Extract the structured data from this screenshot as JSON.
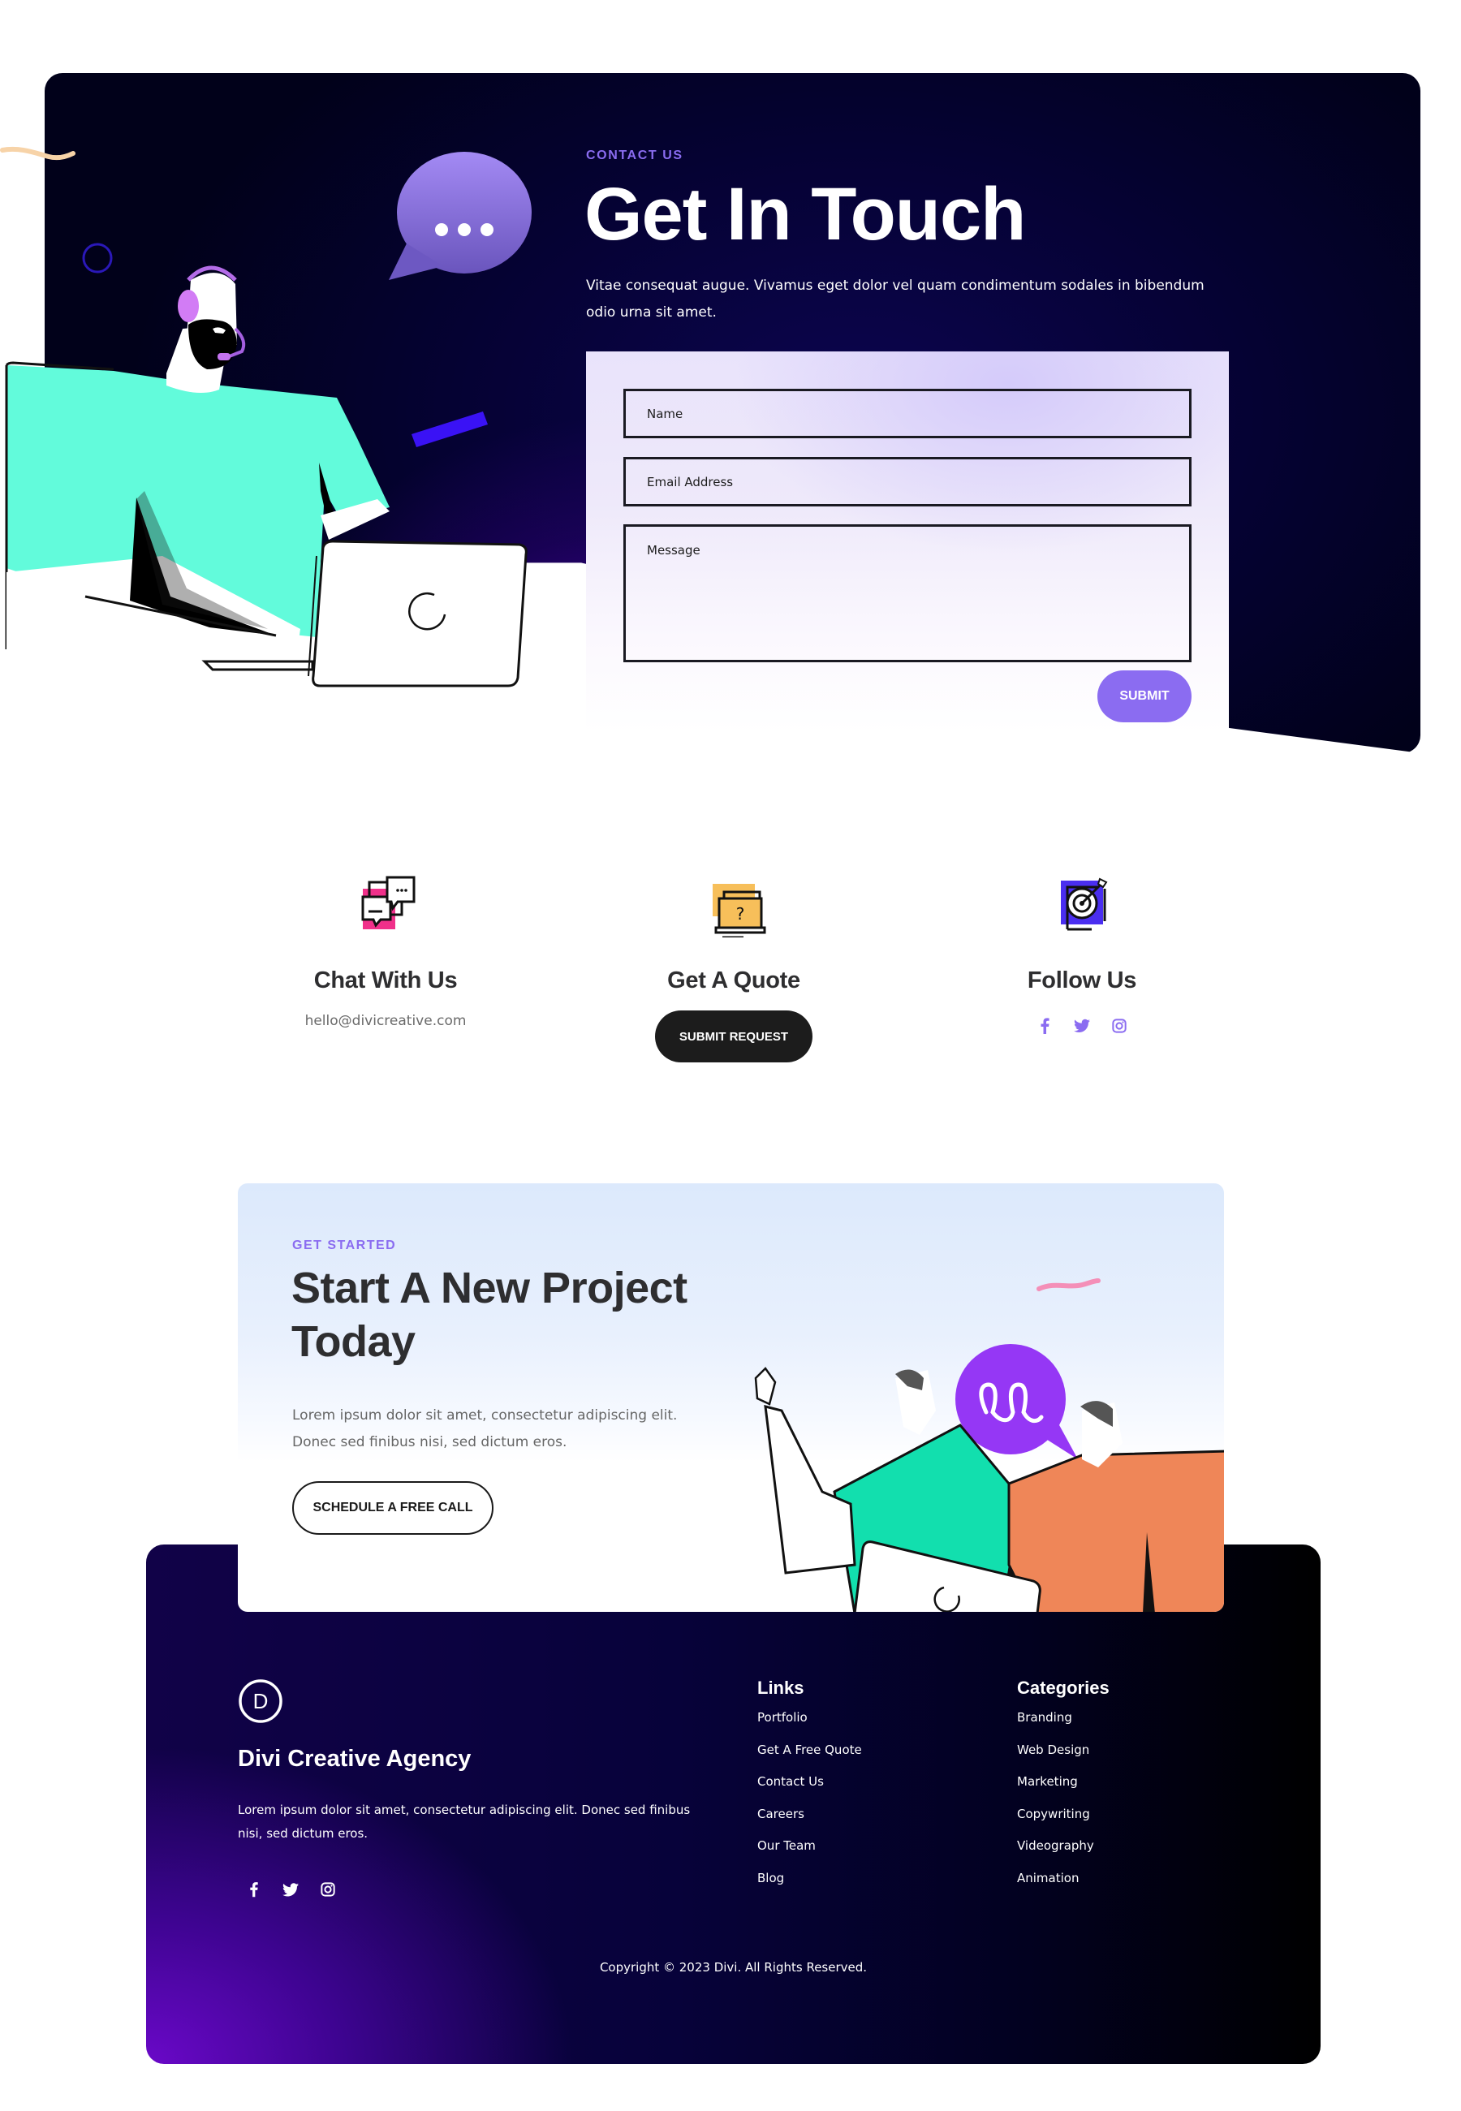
{
  "hero": {
    "eyebrow": "CONTACT US",
    "title": "Get In Touch",
    "description": "Vitae consequat augue. Vivamus eget dolor vel quam condimentum sodales in bibendum odio urna sit amet.",
    "form": {
      "name_placeholder": "Name",
      "email_placeholder": "Email Address",
      "message_placeholder": "Message",
      "submit_label": "SUBMIT"
    }
  },
  "contact_columns": [
    {
      "icon": "chat-bubbles-icon",
      "title": "Chat With Us",
      "email": "hello@divicreative.com"
    },
    {
      "icon": "quote-laptop-icon",
      "title": "Get A Quote",
      "button_label": "SUBMIT REQUEST"
    },
    {
      "icon": "target-icon",
      "title": "Follow Us",
      "social": [
        "facebook-icon",
        "twitter-icon",
        "instagram-icon"
      ]
    }
  ],
  "cta": {
    "eyebrow": "GET STARTED",
    "title": "Start A New Project Today",
    "description": "Lorem ipsum dolor sit amet, consectetur adipiscing elit. Donec sed finibus nisi, sed dictum eros.",
    "button_label": "SCHEDULE A FREE CALL"
  },
  "footer": {
    "logo_letter": "D",
    "brand": "Divi Creative Agency",
    "description": "Lorem ipsum dolor sit amet, consectetur adipiscing elit. Donec sed finibus nisi, sed dictum eros.",
    "social": [
      "facebook-icon",
      "twitter-icon",
      "instagram-icon"
    ],
    "links": {
      "heading": "Links",
      "items": [
        "Portfolio",
        "Get A Free Quote",
        "Contact Us",
        "Careers",
        "Our Team",
        "Blog"
      ]
    },
    "categories": {
      "heading": "Categories",
      "items": [
        "Branding",
        "Web Design",
        "Marketing",
        "Copywriting",
        "Videography",
        "Animation"
      ]
    },
    "copyright": "Copyright © 2023 Divi. All Rights Reserved."
  },
  "colors": {
    "accent_purple": "#8b6cf1",
    "hero_dark": "#050233",
    "button_dark": "#1c1c1c",
    "pink": "#f0308a",
    "amber": "#f7bf5a",
    "indigo": "#4a2ef0",
    "teal": "#62fbdb",
    "orange": "#ef8658"
  }
}
